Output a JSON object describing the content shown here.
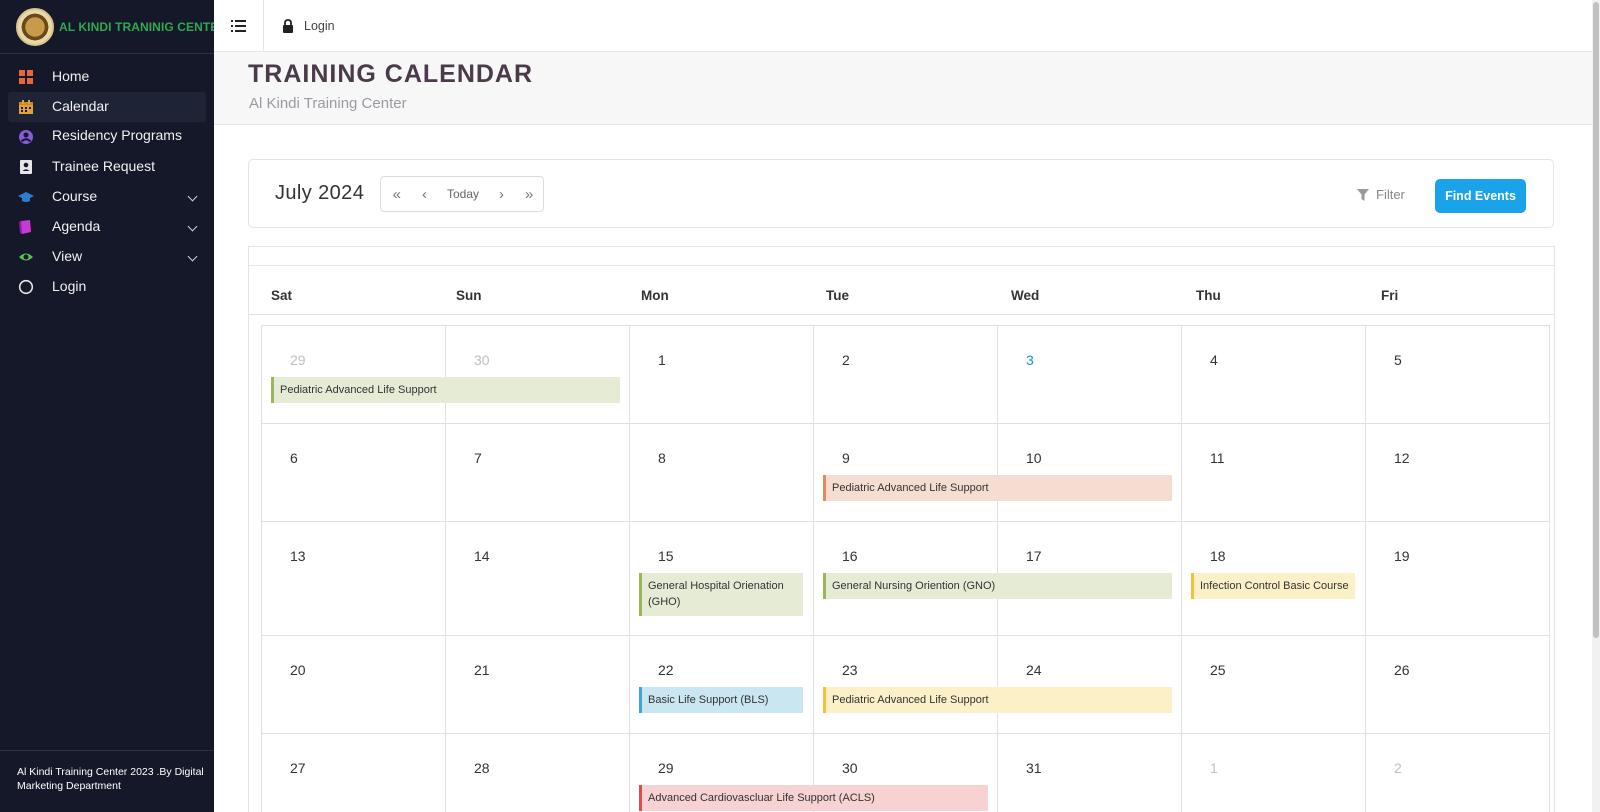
{
  "sidebar": {
    "brand_name": "AL KINDI TRANINIG CENTER",
    "items": [
      {
        "label": "Home",
        "icon": "grid-icon",
        "color": "#e8663d"
      },
      {
        "label": "Calendar",
        "icon": "calendar-icon",
        "color": "#e0a13a"
      },
      {
        "label": "Residency Programs",
        "icon": "user-circle-icon",
        "color": "#8a5bd6"
      },
      {
        "label": "Trainee Request",
        "icon": "id-card-icon",
        "color": "#e6e6e6"
      },
      {
        "label": "Course",
        "icon": "graduation-cap-icon",
        "color": "#2a7fd4"
      },
      {
        "label": "Agenda",
        "icon": "book-icon",
        "color": "#c83ad6"
      },
      {
        "label": "View",
        "icon": "eye-icon",
        "color": "#5cbf52"
      },
      {
        "label": "Login",
        "icon": "circle-icon",
        "color": "#e6e6e6"
      }
    ],
    "footer": "Al Kindi Training Center 2023 .By Digital Marketing Department"
  },
  "topbar": {
    "login_label": "Login"
  },
  "header": {
    "title": "TRAINING CALENDAR",
    "subtitle": "Al Kindi Training Center"
  },
  "toolbar": {
    "month": "July 2024",
    "prev_year": "«",
    "prev": "‹",
    "today": "Today",
    "next": "›",
    "next_year": "»",
    "filter": "Filter",
    "find_events": "Find Events"
  },
  "calendar": {
    "weekdays": [
      "Sat",
      "Sun",
      "Mon",
      "Tue",
      "Wed",
      "Thu",
      "Fri"
    ],
    "weeks": [
      {
        "days": [
          {
            "n": "29",
            "muted": true
          },
          {
            "n": "30",
            "muted": true
          },
          {
            "n": "1"
          },
          {
            "n": "2"
          },
          {
            "n": "3",
            "today": true
          },
          {
            "n": "4"
          },
          {
            "n": "5"
          }
        ]
      },
      {
        "days": [
          {
            "n": "6"
          },
          {
            "n": "7"
          },
          {
            "n": "8"
          },
          {
            "n": "9"
          },
          {
            "n": "10"
          },
          {
            "n": "11"
          },
          {
            "n": "12"
          }
        ]
      },
      {
        "days": [
          {
            "n": "13"
          },
          {
            "n": "14"
          },
          {
            "n": "15"
          },
          {
            "n": "16"
          },
          {
            "n": "17"
          },
          {
            "n": "18"
          },
          {
            "n": "19"
          }
        ]
      },
      {
        "days": [
          {
            "n": "20"
          },
          {
            "n": "21"
          },
          {
            "n": "22"
          },
          {
            "n": "23"
          },
          {
            "n": "24"
          },
          {
            "n": "25"
          },
          {
            "n": "26"
          }
        ]
      },
      {
        "days": [
          {
            "n": "27"
          },
          {
            "n": "28"
          },
          {
            "n": "29"
          },
          {
            "n": "30"
          },
          {
            "n": "31"
          },
          {
            "n": "1",
            "muted": true
          },
          {
            "n": "2",
            "muted": true
          }
        ]
      }
    ],
    "events": [
      {
        "title": "Pediatric Advanced Life Support",
        "week": 0,
        "start": 0,
        "span": 2,
        "bg": "#e6ebd6",
        "border": "#9ab85a"
      },
      {
        "title": "Pediatric Advanced Life Support",
        "week": 1,
        "start": 3,
        "span": 2,
        "bg": "#f6ddd2",
        "border": "#e58a5a"
      },
      {
        "title": "General Hospital Orienation (GHO)",
        "week": 2,
        "start": 2,
        "span": 1,
        "bg": "#e6ebd6",
        "border": "#9ab85a"
      },
      {
        "title": "General Nursing Oriention (GNO)",
        "week": 2,
        "start": 3,
        "span": 2,
        "bg": "#e6ebd6",
        "border": "#9ab85a"
      },
      {
        "title": "Infection Control Basic Course",
        "week": 2,
        "start": 5,
        "span": 1,
        "bg": "#fbf0c8",
        "border": "#f0c23a"
      },
      {
        "title": "Basic Life Support (BLS)",
        "week": 3,
        "start": 2,
        "span": 1,
        "bg": "#c9e6f1",
        "border": "#3aa8d6"
      },
      {
        "title": "Pediatric Advanced Life Support",
        "week": 3,
        "start": 3,
        "span": 2,
        "bg": "#fbf0c8",
        "border": "#f0c23a"
      },
      {
        "title": "Advanced Cardiovascluar Life Support (ACLS)",
        "week": 4,
        "start": 2,
        "span": 2,
        "bg": "#f6d2d2",
        "border": "#e04a4a"
      }
    ]
  }
}
